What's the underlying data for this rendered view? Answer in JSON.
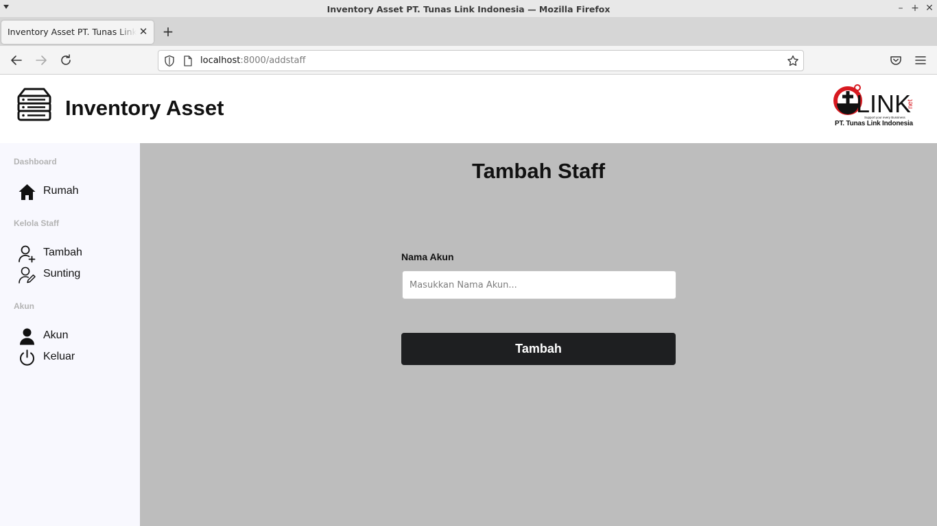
{
  "window": {
    "title": "Inventory Asset PT. Tunas Link Indonesia — Mozilla Firefox",
    "controls": [
      "minimize-icon",
      "maximize-icon",
      "close-icon"
    ]
  },
  "browser": {
    "tab_title": "Inventory Asset PT. Tunas Link Indonesia",
    "url_host": "localhost",
    "url_path": ":8000/addstaff"
  },
  "header": {
    "app_title": "Inventory Asset",
    "company_name": "PT. Tunas Link Indonesia",
    "logo_text": "LINK",
    "logo_suffix": "net",
    "logo_tagline": "Support your every Bussiness"
  },
  "sidebar": {
    "sections": [
      {
        "heading": "Dashboard",
        "items": [
          {
            "label": "Rumah",
            "icon": "home-icon"
          }
        ]
      },
      {
        "heading": "Kelola Staff",
        "items": [
          {
            "label": "Tambah",
            "icon": "user-add-icon"
          },
          {
            "label": "Sunting",
            "icon": "user-edit-icon"
          }
        ]
      },
      {
        "heading": "Akun",
        "items": [
          {
            "label": "Akun",
            "icon": "user-icon"
          },
          {
            "label": "Keluar",
            "icon": "power-icon"
          }
        ]
      }
    ]
  },
  "main": {
    "title": "Tambah Staff",
    "field_label": "Nama Akun",
    "input_value": "",
    "input_placeholder": "Masukkan Nama Akun...",
    "submit_label": "Tambah"
  },
  "colors": {
    "sidebar_bg": "#f8f8fe",
    "main_bg": "#bdbdbd",
    "button_bg": "#1e1f21",
    "brand_red": "#d71920"
  }
}
